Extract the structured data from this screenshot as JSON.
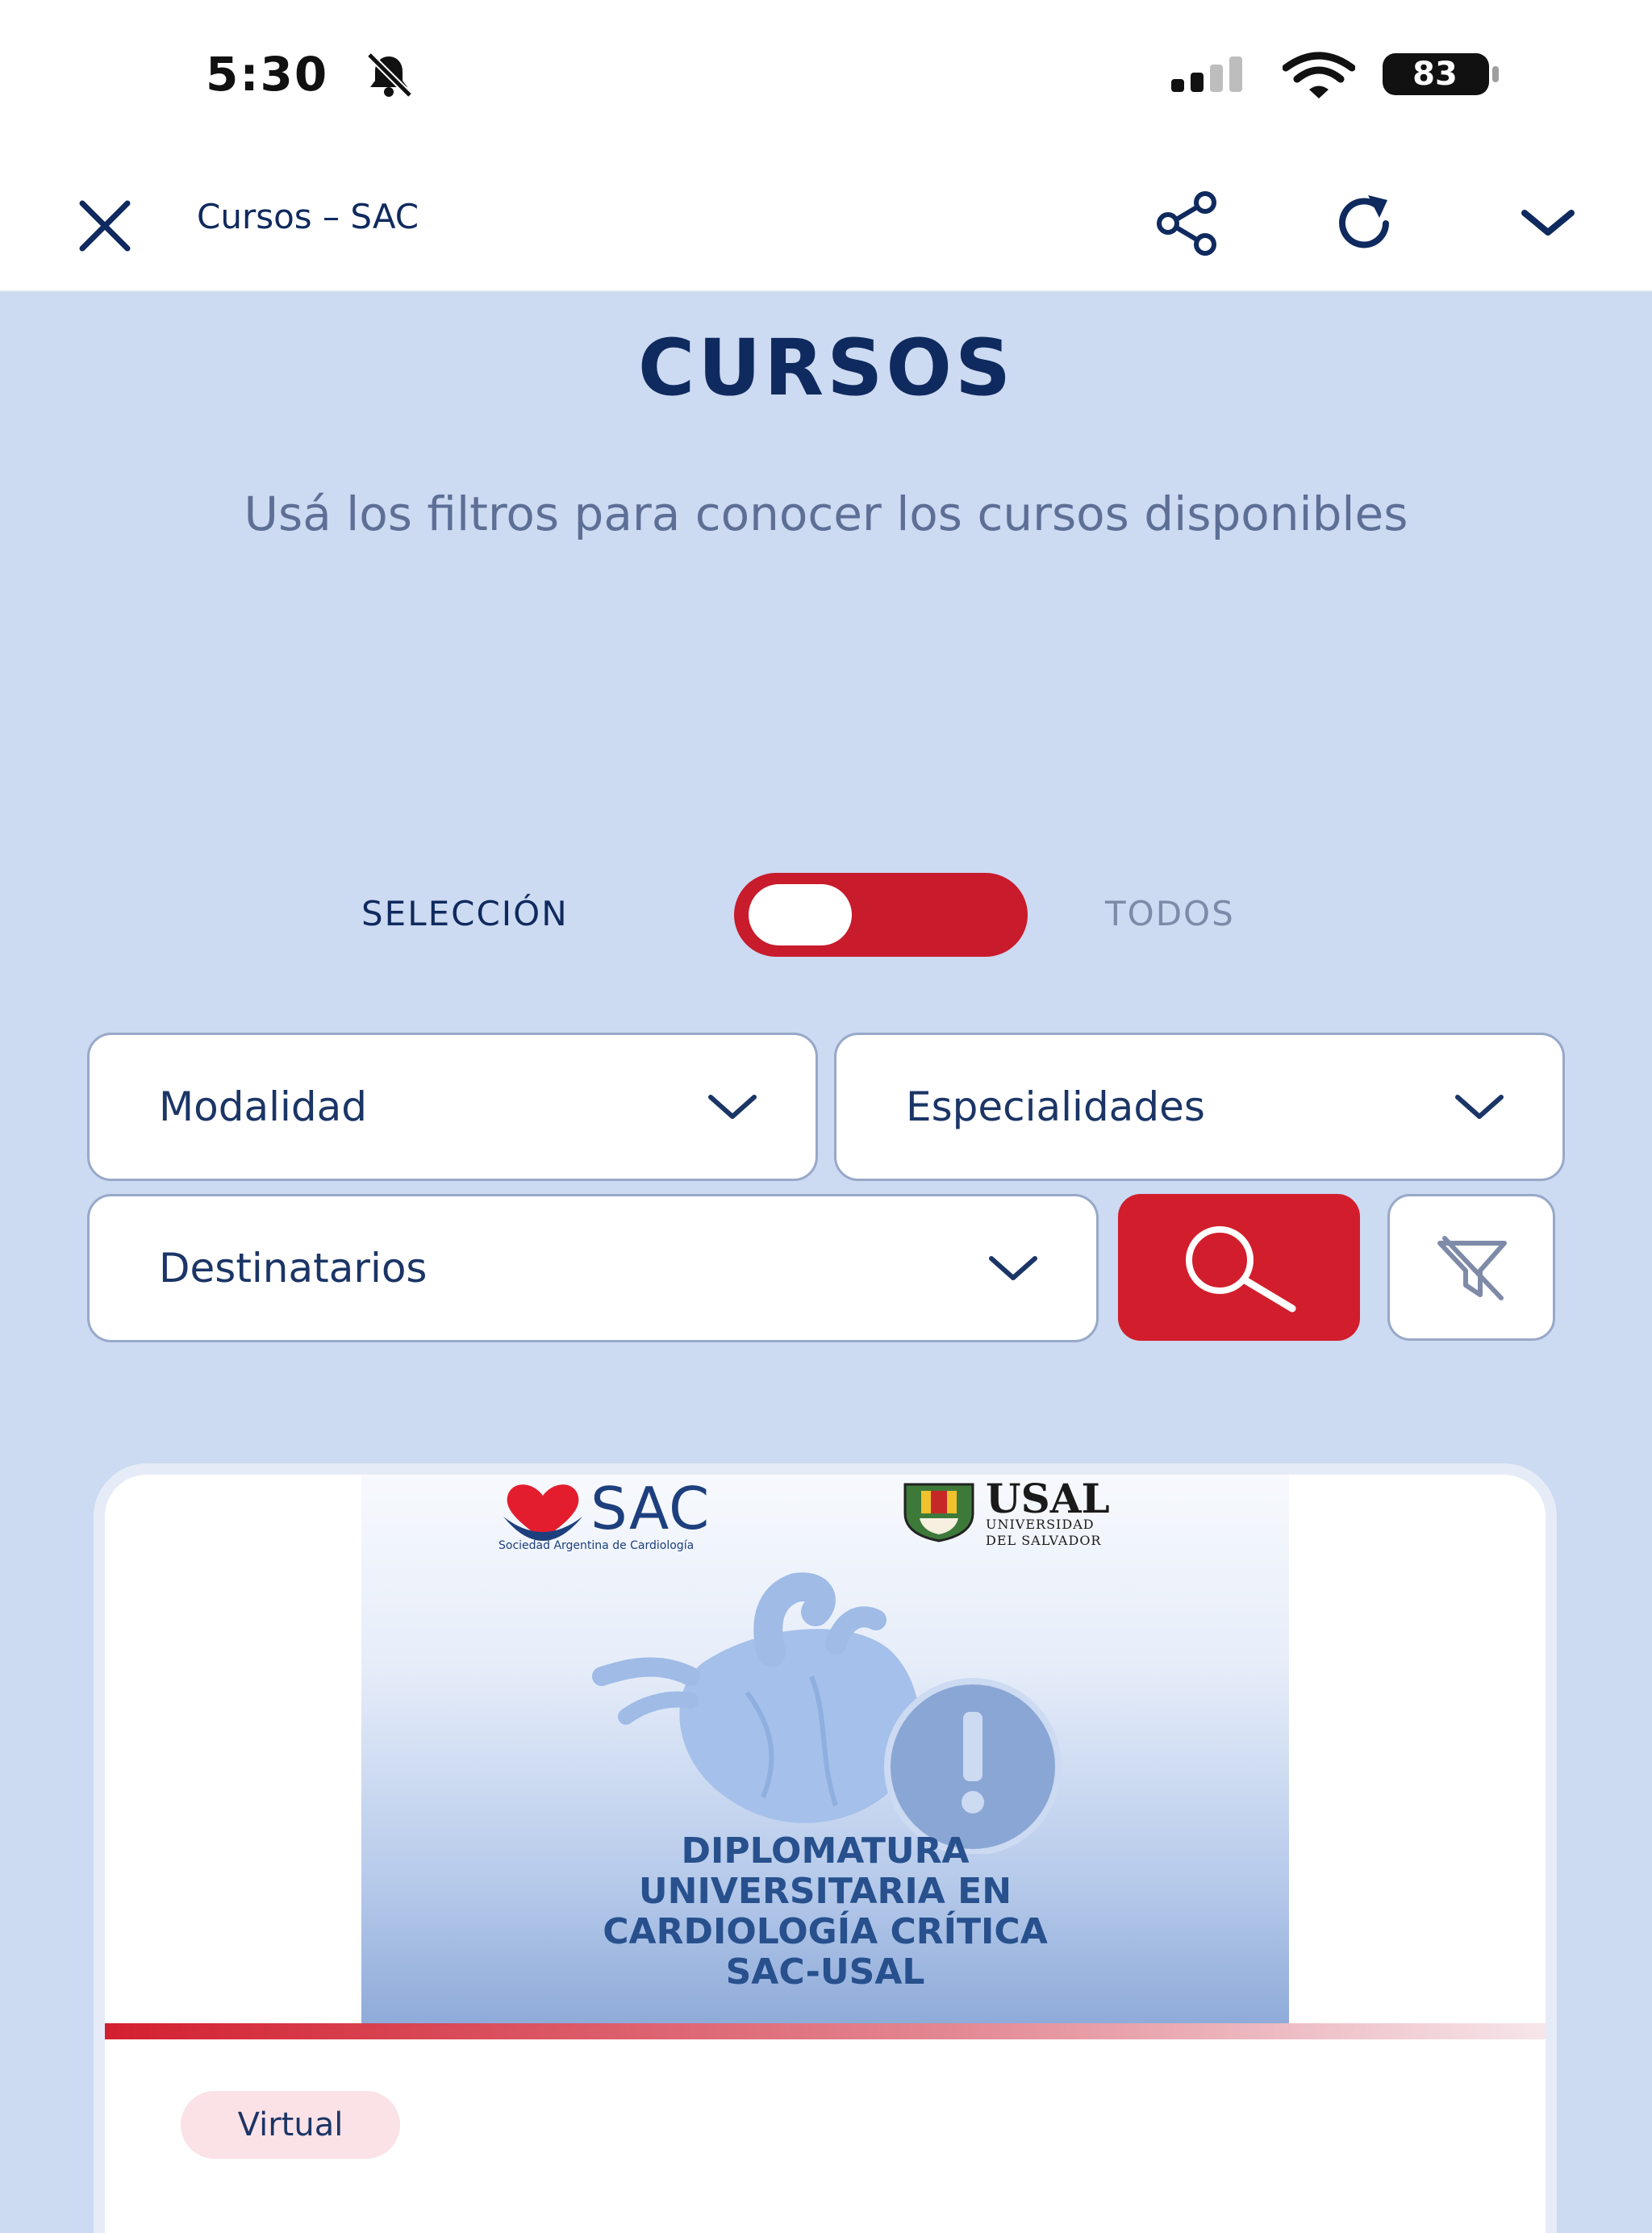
{
  "status_bar": {
    "time": "5:30",
    "battery": "83"
  },
  "nav": {
    "title": "Cursos – SAC"
  },
  "page": {
    "title": "CURSOS",
    "subtitle": "Usá los filtros para conocer los cursos disponibles"
  },
  "toggle": {
    "left_label": "SELECCIÓN",
    "right_label": "TODOS"
  },
  "filters": {
    "modalidad": "Modalidad",
    "especialidades": "Especialidades",
    "destinatarios": "Destinatarios"
  },
  "course_card": {
    "logo_sac": "SAC",
    "logo_sac_sub": "Sociedad Argentina de Cardiología",
    "logo_usal": "USAL",
    "logo_usal_sub1": "UNIVERSIDAD",
    "logo_usal_sub2": "DEL SALVADOR",
    "title_lines": [
      "DIPLOMATURA",
      "UNIVERSITARIA EN",
      "CARDIOLOGÍA CRÍTICA",
      "SAC-USAL"
    ],
    "tag": "Virtual"
  },
  "colors": {
    "accent": "#c81b2b",
    "navy": "#0f2a5e",
    "page_bg": "#ccdaf2"
  }
}
